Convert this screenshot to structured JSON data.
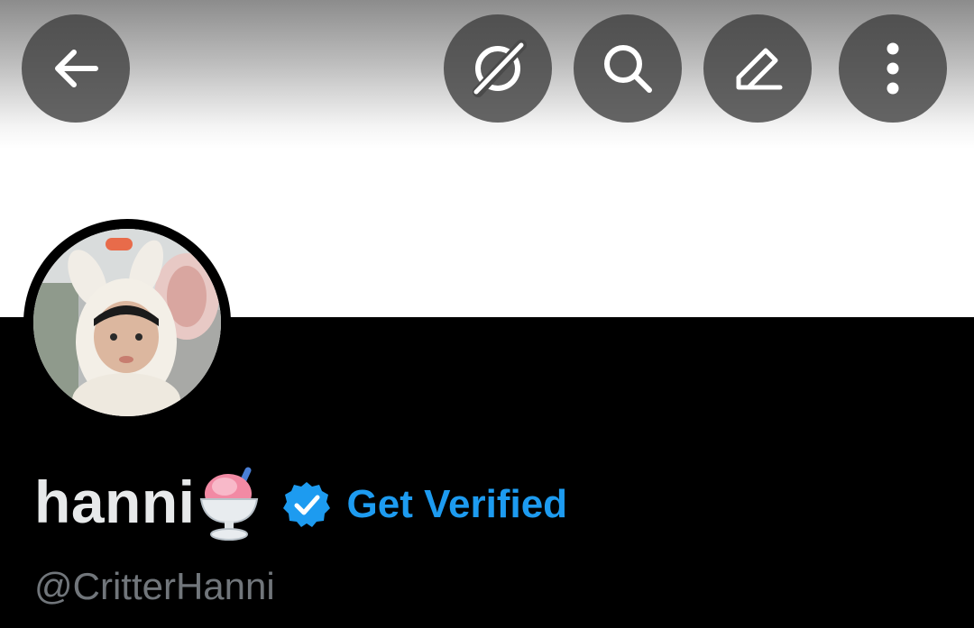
{
  "header": {
    "buttons": [
      {
        "name": "back",
        "icon": "arrow-left-icon"
      },
      {
        "name": "grok",
        "icon": "grok-icon"
      },
      {
        "name": "search",
        "icon": "search-icon"
      },
      {
        "name": "edit",
        "icon": "pencil-icon"
      },
      {
        "name": "more",
        "icon": "more-vertical-icon"
      }
    ]
  },
  "profile": {
    "display_name": "hanni",
    "name_emoji": "shaved-ice-emoji",
    "verified_badge": "verified-badge-icon",
    "get_verified_label": "Get Verified",
    "handle": "@CritterHanni"
  },
  "colors": {
    "background": "#000000",
    "banner": "#ffffff",
    "name": "#e7e9ea",
    "accent": "#1d9bf0",
    "handle": "#71767b",
    "icon_button_bg": "#3c3c3c"
  }
}
